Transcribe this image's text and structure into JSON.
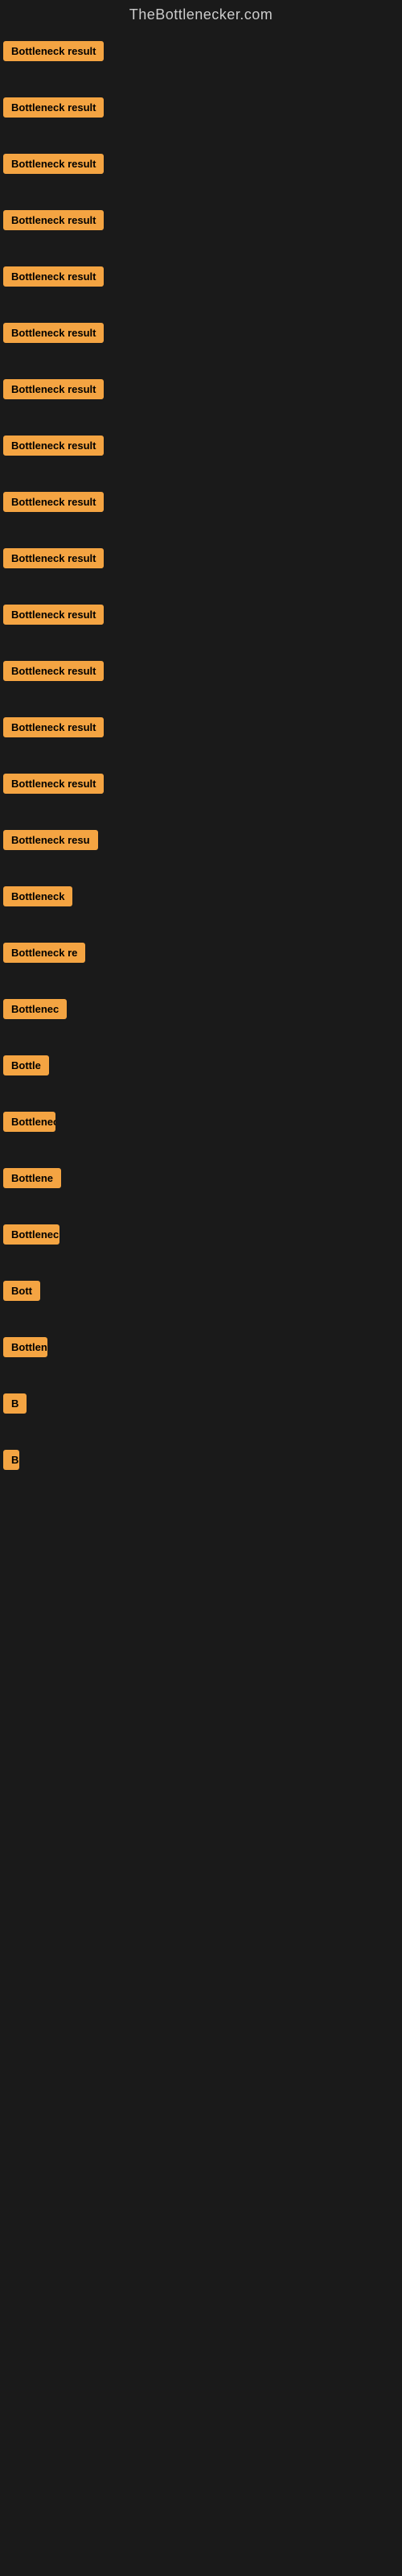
{
  "site": {
    "title": "TheBottlenecker.com"
  },
  "items": [
    {
      "label": "Bottleneck result"
    },
    {
      "label": "Bottleneck result"
    },
    {
      "label": "Bottleneck result"
    },
    {
      "label": "Bottleneck result"
    },
    {
      "label": "Bottleneck result"
    },
    {
      "label": "Bottleneck result"
    },
    {
      "label": "Bottleneck result"
    },
    {
      "label": "Bottleneck result"
    },
    {
      "label": "Bottleneck result"
    },
    {
      "label": "Bottleneck result"
    },
    {
      "label": "Bottleneck result"
    },
    {
      "label": "Bottleneck result"
    },
    {
      "label": "Bottleneck result"
    },
    {
      "label": "Bottleneck result"
    },
    {
      "label": "Bottleneck resu"
    },
    {
      "label": "Bottleneck"
    },
    {
      "label": "Bottleneck re"
    },
    {
      "label": "Bottlenec"
    },
    {
      "label": "Bottle"
    },
    {
      "label": "Bottlenec"
    },
    {
      "label": "Bottlene"
    },
    {
      "label": "Bottleneck"
    },
    {
      "label": "Bott"
    },
    {
      "label": "Bottlene"
    },
    {
      "label": "B"
    },
    {
      "label": "B"
    }
  ],
  "colors": {
    "badge_bg": "#f4a442",
    "badge_text": "#000000",
    "site_title": "#cccccc",
    "page_bg": "#1a1a1a"
  }
}
